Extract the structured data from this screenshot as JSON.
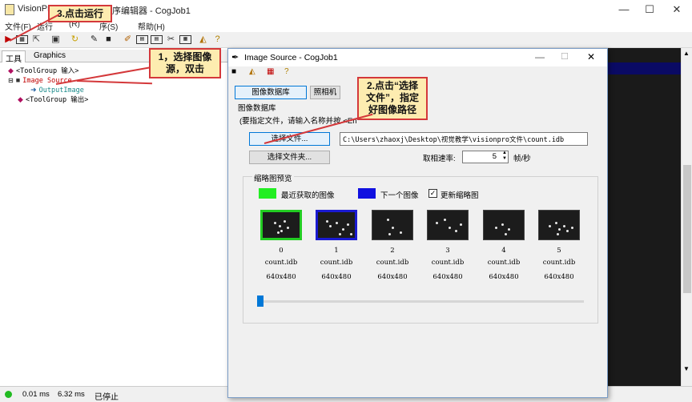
{
  "window": {
    "title_prefix": "VisionPr",
    "title_suffix": "序编辑器 - CogJob1",
    "controls": {
      "minimize": "—",
      "maximize": "☐",
      "close": "✕"
    }
  },
  "menubar": {
    "items": [
      "文件(F)",
      "运行",
      "(R)",
      "序(S)",
      "帮助(H)"
    ]
  },
  "left_panel": {
    "tabs": [
      "工具",
      "Graphics"
    ],
    "tree": [
      "<ToolGroup 输入>",
      "Image Source",
      "OutputImage",
      "<ToolGroup 输出>"
    ]
  },
  "statusbar": {
    "time1": "0.01 ms",
    "time2": "6.32 ms",
    "state": "已停止"
  },
  "dialog": {
    "title": "Image Source - CogJob1",
    "tabs": [
      "图像数据库",
      "照相机"
    ],
    "group_label": "图像数据库",
    "hint": "(要指定文件，请输入名称并按 <En",
    "select_file_button": "选择文件...",
    "select_folder_button": "选择文件夹...",
    "file_path": "C:\\Users\\zhaoxj\\Desktop\\视觉教学\\visionpro文件\\count.idb",
    "frame_rate_label": "取相速率:",
    "frame_rate_value": "5",
    "frame_rate_unit": "帧/秒",
    "thumbnail_group_label": "缩略图预览",
    "legend_recent": "最近获取的图像",
    "legend_next": "下一个图像",
    "update_thumbnails_label": "更新缩略图",
    "update_thumbnails_checked": true,
    "thumbnails": [
      {
        "index": "0",
        "name": "count.idb",
        "size": "640x480",
        "border": "#22cc22"
      },
      {
        "index": "1",
        "name": "count.idb",
        "size": "640x480",
        "border": "#1a1ad0"
      },
      {
        "index": "2",
        "name": "count.idb",
        "size": "640x480",
        "border": ""
      },
      {
        "index": "3",
        "name": "count.idb",
        "size": "640x480",
        "border": ""
      },
      {
        "index": "4",
        "name": "count.idb",
        "size": "640x480",
        "border": ""
      },
      {
        "index": "5",
        "name": "count.idb",
        "size": "640x480",
        "border": ""
      }
    ],
    "slider_value": 0
  },
  "callouts": {
    "run": "3.点击运行",
    "select_image_1": "1，选择图像",
    "select_image_2": "源，双击",
    "select_file_1": "2.点击“选择",
    "select_file_2": "文件”，指定",
    "select_file_3": "好图像路径"
  },
  "colors": {
    "recent": "#22ee22",
    "next": "#1010e0",
    "callout_bg": "#fdecb0",
    "callout_border": "#d4383a"
  }
}
